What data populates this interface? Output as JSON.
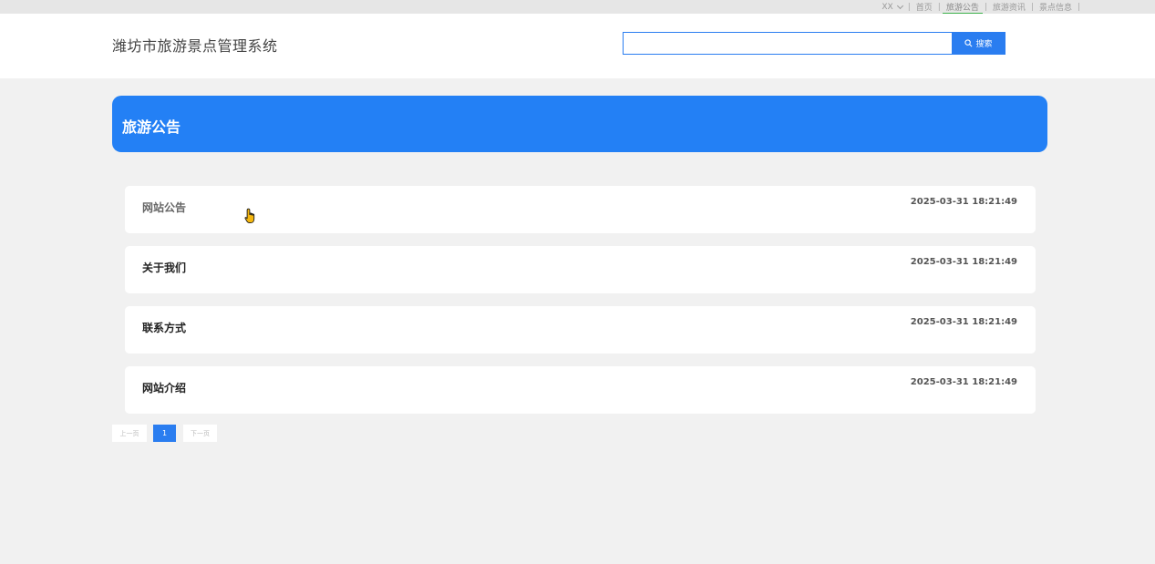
{
  "topnav": {
    "user": "XX",
    "items": [
      {
        "label": "首页",
        "active": false
      },
      {
        "label": "旅游公告",
        "active": true
      },
      {
        "label": "旅游资讯",
        "active": false
      },
      {
        "label": "景点信息",
        "active": false
      }
    ]
  },
  "header": {
    "site_title": "潍坊市旅游景点管理系统",
    "search": {
      "value": "",
      "placeholder": ""
    },
    "search_button_label": "搜索"
  },
  "banner": {
    "title": "旅游公告"
  },
  "notices": [
    {
      "title": "网站公告",
      "date": "2025-03-31 18:21:49"
    },
    {
      "title": "关于我们",
      "date": "2025-03-31 18:21:49"
    },
    {
      "title": "联系方式",
      "date": "2025-03-31 18:21:49"
    },
    {
      "title": "网站介绍",
      "date": "2025-03-31 18:21:49"
    }
  ],
  "pagination": {
    "prev_label": "上一页",
    "current_page": "1",
    "next_label": "下一页"
  },
  "colors": {
    "accent": "#2380f5",
    "active_underline": "#3cb04b",
    "page_bg": "#f1f1f1"
  }
}
